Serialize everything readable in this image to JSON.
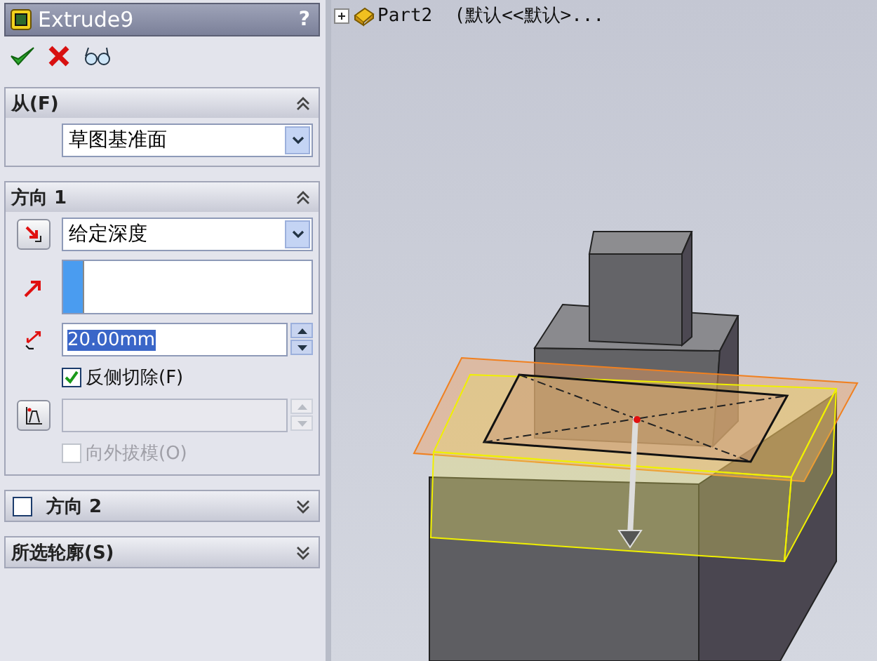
{
  "property_manager": {
    "title": "Extrude9",
    "help": "?"
  },
  "actions": [
    {
      "kind": "ok"
    },
    {
      "kind": "cancel"
    },
    {
      "kind": "preview"
    }
  ],
  "from_section": {
    "title": "从(F)",
    "expanded": true,
    "start_condition": "草图基准面"
  },
  "direction1": {
    "title": "方向 1",
    "expanded": true,
    "end_condition": "给定深度",
    "depth": "20.00mm",
    "depth_selected": true,
    "flip_side": {
      "label": "反侧切除(F)",
      "checked": true,
      "disabled": false
    },
    "draft_outward": {
      "label": "向外拔模(O)",
      "checked": false,
      "disabled": true
    }
  },
  "direction2": {
    "title": "方向 2",
    "expanded": false,
    "checked": false
  },
  "selected_contours": {
    "title": "所选轮廓(S)",
    "expanded": false
  },
  "tree": {
    "root": "Part2  (默认<<默认>...",
    "expanded": false
  }
}
